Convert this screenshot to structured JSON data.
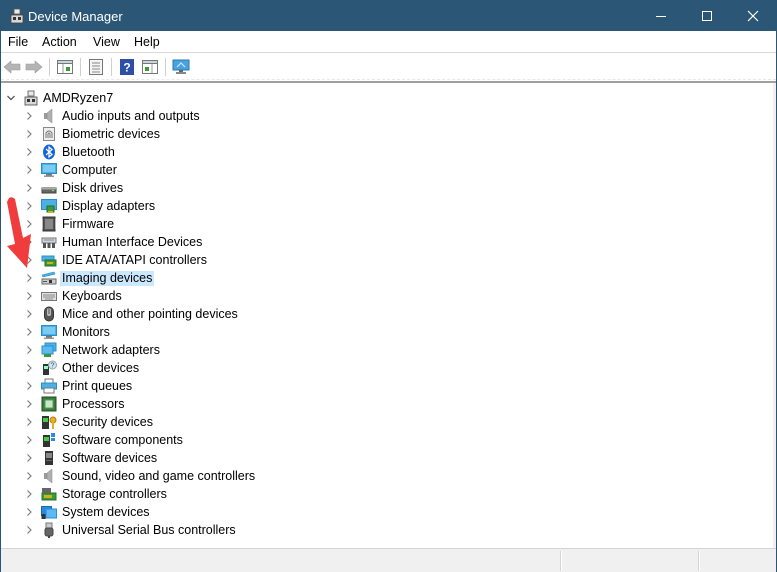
{
  "window": {
    "title": "Device Manager",
    "controls": {
      "minimize": "minimize",
      "maximize": "maximize",
      "close": "close"
    },
    "colors": {
      "titlebar": "#2c5676",
      "selection": "#cce8ff",
      "annotation_arrow": "#f03c3c"
    }
  },
  "menubar": {
    "items": [
      {
        "label": "File"
      },
      {
        "label": "Action"
      },
      {
        "label": "View"
      },
      {
        "label": "Help"
      }
    ]
  },
  "toolbar": {
    "buttons": [
      {
        "name": "back",
        "icon": "arrow-left-icon",
        "enabled": false
      },
      {
        "name": "forward",
        "icon": "arrow-right-icon",
        "enabled": false
      },
      {
        "name": "show-hide-console-tree",
        "icon": "console-tree-icon"
      },
      {
        "name": "properties",
        "icon": "properties-icon"
      },
      {
        "name": "help",
        "icon": "help-icon"
      },
      {
        "name": "show-action-pane",
        "icon": "action-pane-icon"
      },
      {
        "name": "scan-hardware-changes",
        "icon": "monitor-scan-icon"
      }
    ]
  },
  "tree": {
    "root": {
      "label": "AMDRyzen7",
      "icon": "computer-node-icon",
      "expanded": true
    },
    "selected_index": 9,
    "items": [
      {
        "label": "Audio inputs and outputs",
        "icon": "speaker-icon"
      },
      {
        "label": "Biometric devices",
        "icon": "biometric-icon"
      },
      {
        "label": "Bluetooth",
        "icon": "bluetooth-icon"
      },
      {
        "label": "Computer",
        "icon": "computer-icon"
      },
      {
        "label": "Disk drives",
        "icon": "disk-drive-icon"
      },
      {
        "label": "Display adapters",
        "icon": "display-adapter-icon"
      },
      {
        "label": "Firmware",
        "icon": "firmware-icon"
      },
      {
        "label": "Human Interface Devices",
        "icon": "hid-icon"
      },
      {
        "label": "IDE ATA/ATAPI controllers",
        "icon": "ide-controller-icon"
      },
      {
        "label": "Imaging devices",
        "icon": "imaging-device-icon"
      },
      {
        "label": "Keyboards",
        "icon": "keyboard-icon"
      },
      {
        "label": "Mice and other pointing devices",
        "icon": "mouse-icon"
      },
      {
        "label": "Monitors",
        "icon": "monitor-icon"
      },
      {
        "label": "Network adapters",
        "icon": "network-adapter-icon"
      },
      {
        "label": "Other devices",
        "icon": "other-devices-icon"
      },
      {
        "label": "Print queues",
        "icon": "printer-icon"
      },
      {
        "label": "Processors",
        "icon": "processor-icon"
      },
      {
        "label": "Security devices",
        "icon": "security-device-icon"
      },
      {
        "label": "Software components",
        "icon": "software-component-icon"
      },
      {
        "label": "Software devices",
        "icon": "software-device-icon"
      },
      {
        "label": "Sound, video and game controllers",
        "icon": "sound-controller-icon"
      },
      {
        "label": "Storage controllers",
        "icon": "storage-controller-icon"
      },
      {
        "label": "System devices",
        "icon": "system-devices-icon"
      },
      {
        "label": "Universal Serial Bus controllers",
        "icon": "usb-icon"
      }
    ]
  }
}
